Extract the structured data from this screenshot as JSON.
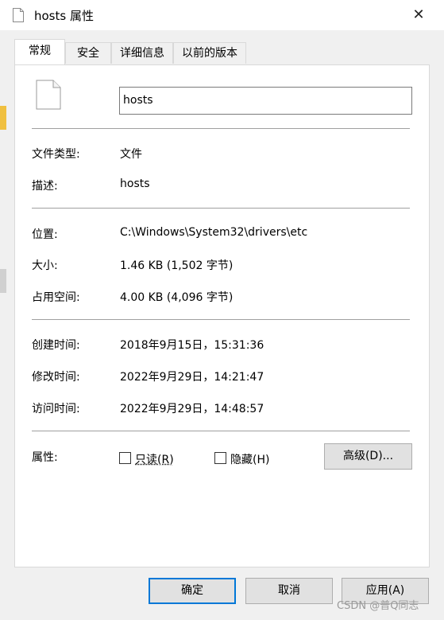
{
  "window": {
    "title": "hosts 属性",
    "close_glyph": "✕"
  },
  "tabs": [
    {
      "label": "常规",
      "active": true
    },
    {
      "label": "安全",
      "active": false
    },
    {
      "label": "详细信息",
      "active": false
    },
    {
      "label": "以前的版本",
      "active": false
    }
  ],
  "general": {
    "filename": "hosts",
    "rows": {
      "type": {
        "label": "文件类型:",
        "value": "文件"
      },
      "desc": {
        "label": "描述:",
        "value": "hosts"
      },
      "location": {
        "label": "位置:",
        "value": "C:\\Windows\\System32\\drivers\\etc"
      },
      "size": {
        "label": "大小:",
        "value": "1.46 KB (1,502 字节)"
      },
      "disk": {
        "label": "占用空间:",
        "value": "4.00 KB (4,096 字节)"
      },
      "created": {
        "label": "创建时间:",
        "value": "2018年9月15日，15:31:36"
      },
      "modified": {
        "label": "修改时间:",
        "value": "2022年9月29日，14:21:47"
      },
      "accessed": {
        "label": "访问时间:",
        "value": "2022年9月29日，14:48:57"
      }
    },
    "attributes": {
      "label": "属性:",
      "readonly": {
        "label": "只读(R)",
        "checked": false
      },
      "hidden": {
        "label": "隐藏(H)",
        "checked": false
      },
      "advanced_label": "高级(D)..."
    }
  },
  "footer": {
    "ok": "确定",
    "cancel": "取消",
    "apply": "应用(A)"
  },
  "watermark": "CSDN @普Q同志",
  "colors": {
    "accent": "#0078d7",
    "panel": "#ffffff",
    "chrome": "#f0f0f0"
  },
  "icons": {
    "title": "file-icon",
    "big": "file-icon",
    "close": "close-icon"
  }
}
